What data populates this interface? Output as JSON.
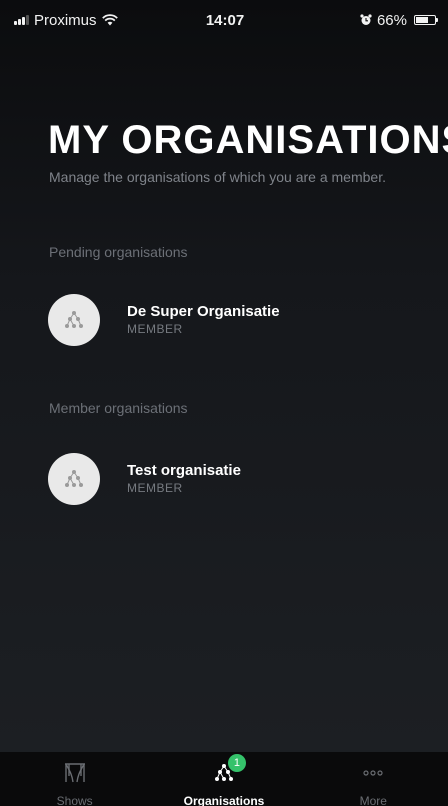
{
  "status_bar": {
    "carrier": "Proximus",
    "time": "14:07",
    "battery": "66%",
    "battery_level": 0.66,
    "icons": [
      "signal-icon",
      "wifi-icon",
      "alarm-icon",
      "battery-icon"
    ]
  },
  "header": {
    "title": "MY ORGANISATIONS",
    "subtitle": "Manage the organisations of which you are a member."
  },
  "pending": {
    "label": "Pending organisations",
    "items": [
      {
        "name": "De Super Organisatie",
        "role": "MEMBER",
        "icon": "organisation-icon"
      }
    ]
  },
  "member": {
    "label": "Member organisations",
    "items": [
      {
        "name": "Test organisatie",
        "role": "MEMBER",
        "icon": "organisation-icon"
      }
    ]
  },
  "tab_bar": {
    "tabs": [
      {
        "label": "Shows",
        "icon": "curtains-icon",
        "active": false
      },
      {
        "label": "Organisations",
        "icon": "organisation-icon",
        "active": true,
        "badge": "1"
      },
      {
        "label": "More",
        "icon": "more-dots-icon",
        "active": false
      }
    ]
  },
  "colors": {
    "background": "#15171b",
    "accent_badge": "#35c26b",
    "avatar_bg": "#e9e9e9",
    "muted_text": "#7f838a"
  }
}
